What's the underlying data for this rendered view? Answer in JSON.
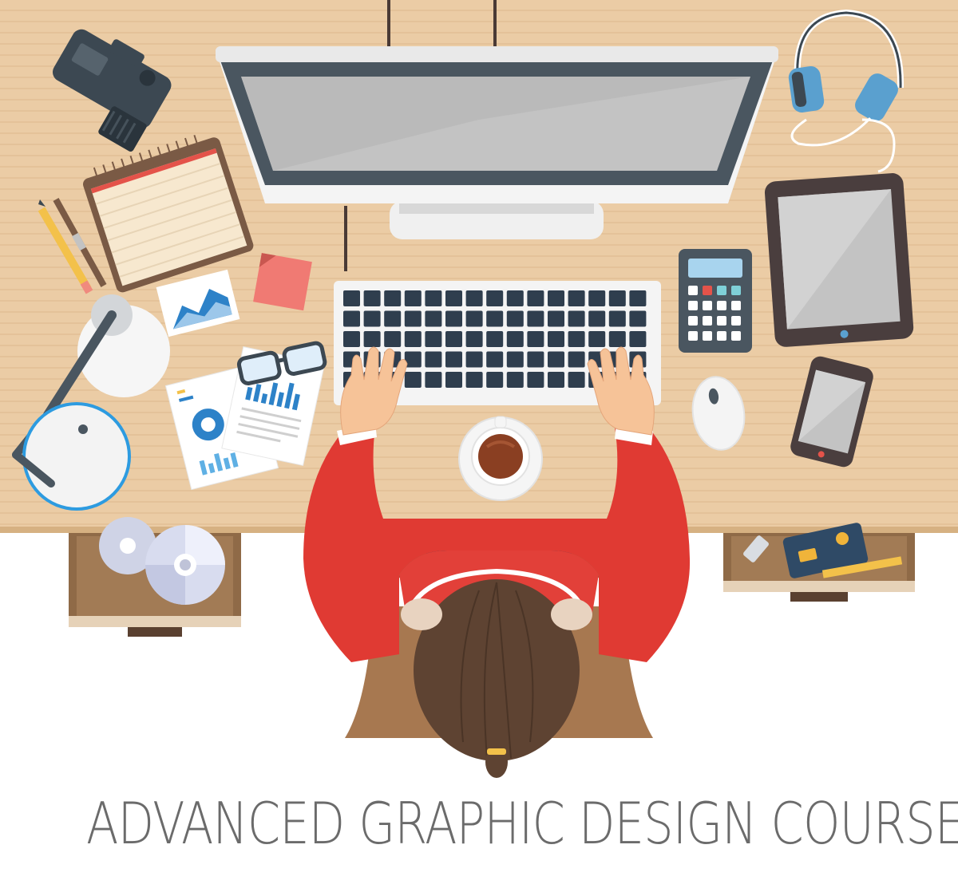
{
  "banner": {
    "title": "ADVANCED GRAPHIC DESIGN COURSES"
  },
  "colors": {
    "desk": "#e9c9a1",
    "desk_lines": "#dcb88c",
    "drawer": "#9a7450",
    "sweater": "#e03a33",
    "hair": "#5e4332",
    "screen": "#b7b7b7",
    "bezel": "#4a5660",
    "keyboard_keys": "#2f3e4e",
    "accent_blue": "#2d82c8",
    "sticky_note": "#f07a73"
  },
  "icons": [
    "camera-icon",
    "headphones-icon",
    "notepad-icon",
    "pencil-icon",
    "brush-icon",
    "sticky-note-icon",
    "chart-card-icon",
    "desk-lamp-icon",
    "documents-icon",
    "glasses-icon",
    "monitor-icon",
    "keyboard-icon",
    "calculator-icon",
    "tablet-icon",
    "smartphone-icon",
    "mouse-icon",
    "coffee-cup-icon",
    "cd-disc-icon",
    "usb-drive-icon",
    "credit-card-icon",
    "ruler-icon",
    "designer-person-icon"
  ]
}
